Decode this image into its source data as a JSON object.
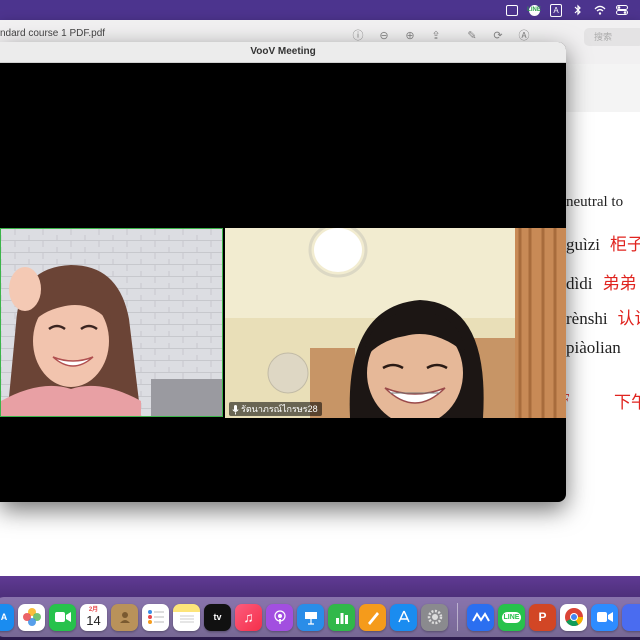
{
  "menubar": {
    "icons": [
      "screen-mirror-icon",
      "line-app-icon",
      "input-source-icon",
      "bluetooth-icon",
      "wifi-icon",
      "control-center-icon"
    ],
    "input_source_letter": "A",
    "line_label": "LINE"
  },
  "pdf_window": {
    "title": "ndard course 1 PDF.pdf",
    "search_placeholder": "搜索",
    "rows": [
      {
        "pinyin": "neutral to",
        "hanzi": ""
      },
      {
        "pinyin": "guìzi",
        "hanzi": "柜子"
      },
      {
        "pinyin": "dìdi",
        "hanzi": "弟弟"
      },
      {
        "pinyin": "rènshi",
        "hanzi": "认识"
      },
      {
        "pinyin": "piàolian",
        "hanzi": ""
      }
    ],
    "bottom_left_hanzi": "F",
    "bottom_right_hanzi": "下午"
  },
  "voov": {
    "title": "VooV Meeting",
    "participant_right_name": "รัตนาภรณ์ไกรษร28"
  },
  "dock": {
    "calendar_month": "2月",
    "calendar_day": "14",
    "apps": [
      {
        "name": "app-store-partial",
        "color": "#1a8cf0"
      },
      {
        "name": "photos",
        "color": "#ffffff"
      },
      {
        "name": "facetime",
        "color": "#27c24c"
      },
      {
        "name": "calendar",
        "color": "#ffffff"
      },
      {
        "name": "contacts",
        "color": "#b9925a"
      },
      {
        "name": "reminders",
        "color": "#ffffff"
      },
      {
        "name": "notes",
        "color": "#fde57a"
      },
      {
        "name": "tv",
        "color": "#111111"
      },
      {
        "name": "music",
        "color": "#fa3c5a"
      },
      {
        "name": "podcasts",
        "color": "#a24fe0"
      },
      {
        "name": "keynote",
        "color": "#2a8de8"
      },
      {
        "name": "numbers",
        "color": "#31b84a"
      },
      {
        "name": "pages",
        "color": "#f59b1b"
      },
      {
        "name": "app-store",
        "color": "#1a8cf0"
      },
      {
        "name": "system-preferences",
        "color": "#8a8a8e"
      },
      {
        "name": "voov",
        "color": "#2b6ff0"
      },
      {
        "name": "line",
        "color": "#27c24c"
      },
      {
        "name": "powerpoint",
        "color": "#d24625"
      },
      {
        "name": "chrome",
        "color": "#ffffff"
      },
      {
        "name": "zoom",
        "color": "#2d8cff"
      },
      {
        "name": "partial-app",
        "color": "#4a6cf0"
      }
    ],
    "tv_label": "tv"
  }
}
